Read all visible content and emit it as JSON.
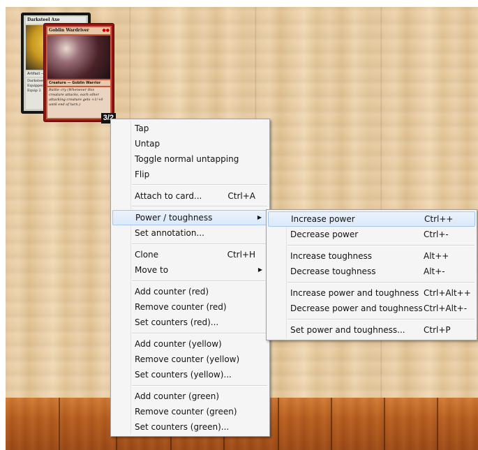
{
  "cards": {
    "axe": {
      "name": "Darksteel Axe",
      "type": "Artifact — Equipment",
      "text": "Darksteel Axe is indestructible. Equipped creature gets +2/+0. Equip 2"
    },
    "goblin": {
      "name": "Goblin Wardriver",
      "mana": "●●",
      "type": "Creature — Goblin Warrior",
      "text": "Battle cry (Whenever this creature attacks, each other attacking creature gets +1/+0 until end of turn.)",
      "pt": "3/2"
    }
  },
  "context_menu": {
    "items": [
      {
        "label": "Tap",
        "shortcut": ""
      },
      {
        "label": "Untap",
        "shortcut": ""
      },
      {
        "label": "Toggle normal untapping",
        "shortcut": ""
      },
      {
        "label": "Flip",
        "shortcut": ""
      },
      {
        "label": "Attach to card...",
        "shortcut": "Ctrl+A"
      },
      {
        "label": "Power / toughness",
        "shortcut": ""
      },
      {
        "label": "Set annotation...",
        "shortcut": ""
      },
      {
        "label": "Clone",
        "shortcut": "Ctrl+H"
      },
      {
        "label": "Move to",
        "shortcut": ""
      },
      {
        "label": "Add counter (red)",
        "shortcut": ""
      },
      {
        "label": "Remove counter (red)",
        "shortcut": ""
      },
      {
        "label": "Set counters (red)...",
        "shortcut": ""
      },
      {
        "label": "Add counter (yellow)",
        "shortcut": ""
      },
      {
        "label": "Remove counter (yellow)",
        "shortcut": ""
      },
      {
        "label": "Set counters (yellow)...",
        "shortcut": ""
      },
      {
        "label": "Add counter (green)",
        "shortcut": ""
      },
      {
        "label": "Remove counter (green)",
        "shortcut": ""
      },
      {
        "label": "Set counters (green)...",
        "shortcut": ""
      }
    ],
    "submenu_arrow": "▶"
  },
  "pt_submenu": {
    "items": [
      {
        "label": "Increase power",
        "shortcut": "Ctrl++"
      },
      {
        "label": "Decrease power",
        "shortcut": "Ctrl+-"
      },
      {
        "label": "Increase toughness",
        "shortcut": "Alt++"
      },
      {
        "label": "Decrease toughness",
        "shortcut": "Alt+-"
      },
      {
        "label": "Increase power and toughness",
        "shortcut": "Ctrl+Alt++"
      },
      {
        "label": "Decrease power and toughness",
        "shortcut": "Ctrl+Alt+-"
      },
      {
        "label": "Set power and toughness...",
        "shortcut": "Ctrl+P"
      }
    ]
  },
  "colors": {
    "menu_bg": "#f5f5f5",
    "highlight_bg": "#dce9f9",
    "highlight_border": "#a8c7ec",
    "table_wood": "#e6c9a0",
    "hand_wood": "#b85d1f"
  }
}
